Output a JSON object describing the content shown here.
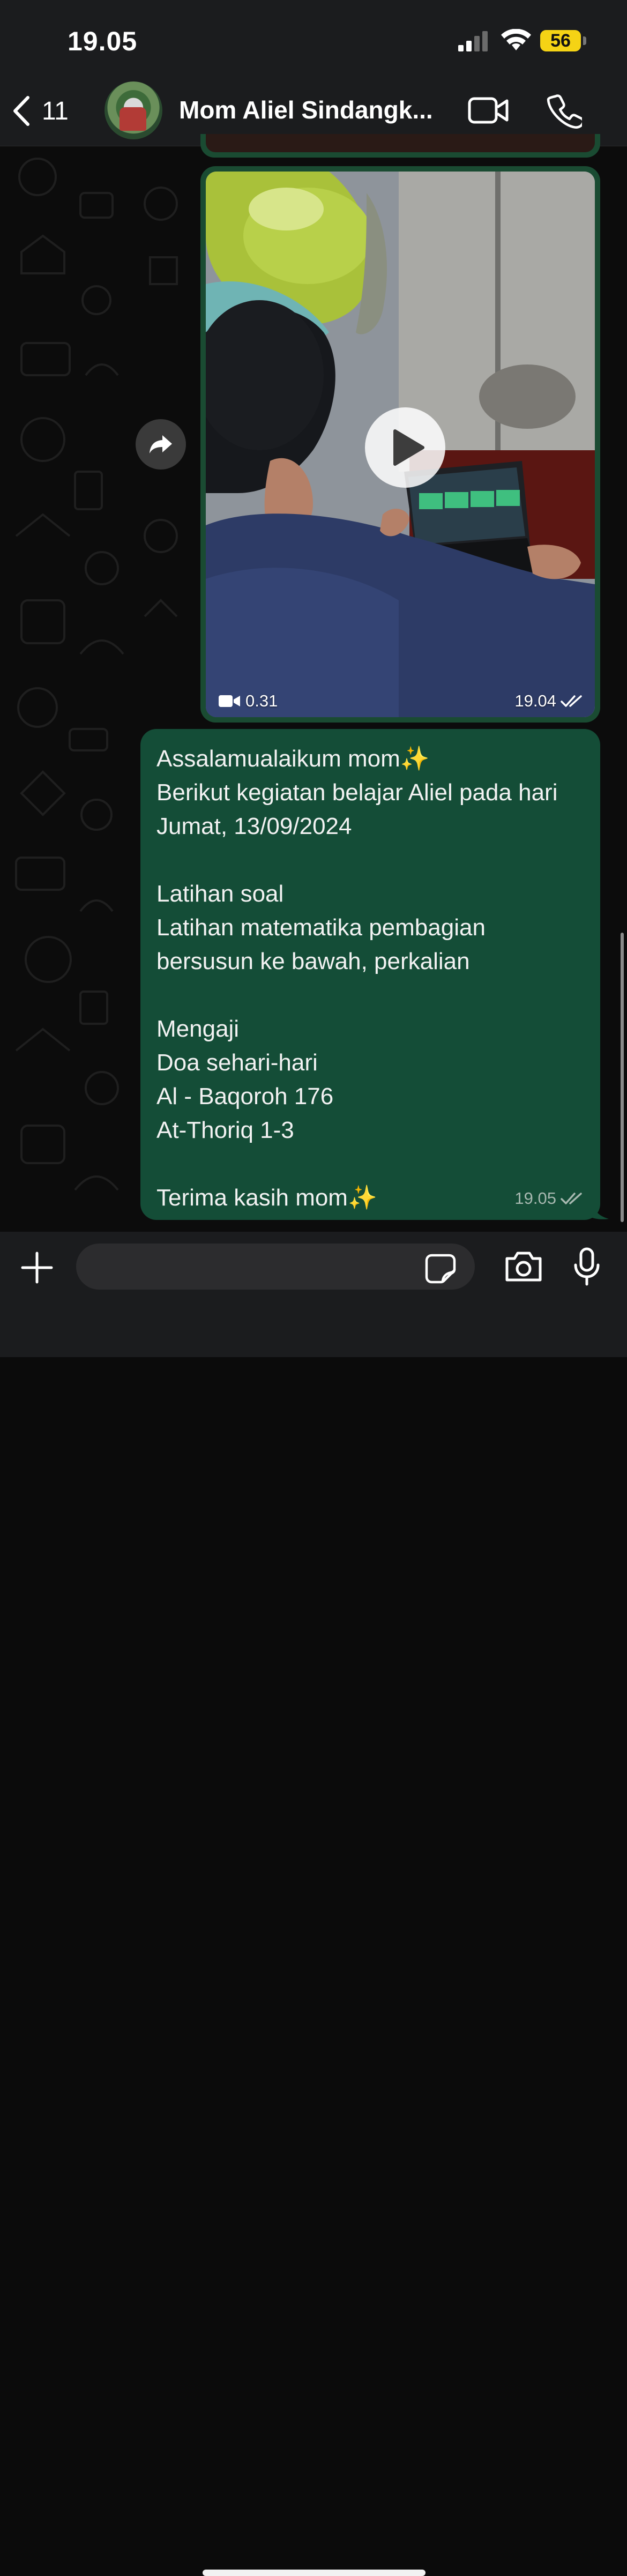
{
  "status_bar": {
    "time": "19.05",
    "battery": "56"
  },
  "header": {
    "back_count": "11",
    "contact_name": "Mom Aliel Sindangk..."
  },
  "video_message": {
    "duration": "0.31",
    "time": "19.04"
  },
  "text_message": {
    "body": "Assalamualaikum mom✨\nBerikut kegiatan belajar Aliel pada hari Jumat, 13/09/2024\n\nLatihan soal\nLatihan matematika pembagian bersusun ke bawah, perkalian\n\nMengaji\nDoa sehari-hari\nAl - Baqoroh 176\nAt-Thoriq 1-3\n\nTerima kasih mom✨",
    "time": "19.05"
  },
  "input": {
    "placeholder": ""
  },
  "colors": {
    "bubble_outgoing": "#144d37",
    "bar_background": "#1b1c1e",
    "battery_yellow": "#f5d315"
  }
}
